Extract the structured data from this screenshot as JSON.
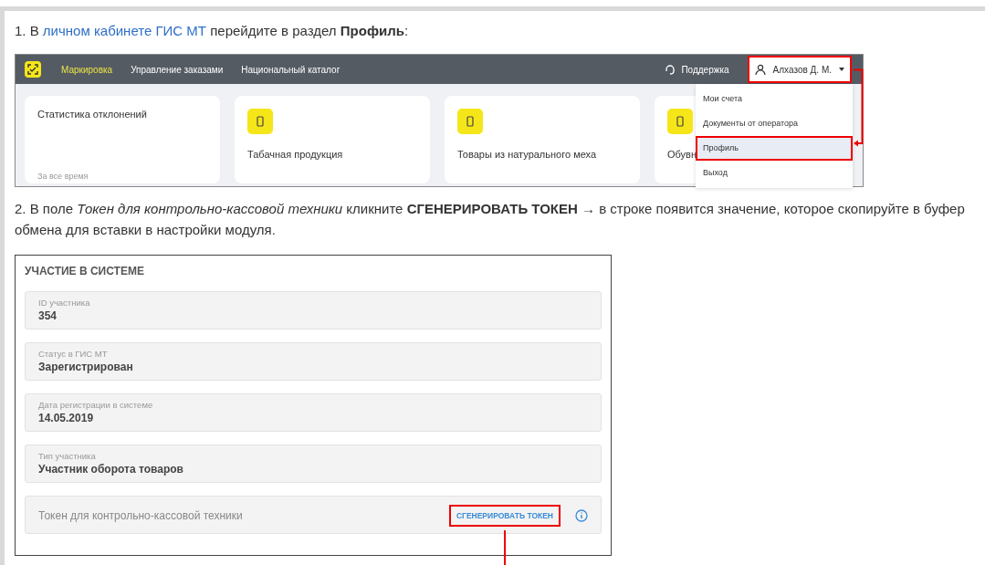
{
  "step1": {
    "prefix": "1. В ",
    "link": "личном кабинете ГИС МТ",
    "suffix": " перейдите в раздел **Профиль**:"
  },
  "screenshot1": {
    "nav": [
      {
        "label": "Маркировка",
        "selected": true
      },
      {
        "label": "Управление заказами",
        "selected": false
      },
      {
        "label": "Национальный каталог",
        "selected": false
      }
    ],
    "support": "Поддержка",
    "user": {
      "name": "Алхазов Д. М.",
      "highlighted": true
    },
    "cards": [
      {
        "kind": "stats",
        "title": "Статистика отклонений",
        "footer": "За все время"
      },
      {
        "kind": "category",
        "title": "Табачная продукция"
      },
      {
        "kind": "category",
        "title": "Товары из натурального меха"
      },
      {
        "kind": "category",
        "title": "Обувн"
      }
    ],
    "menu": [
      {
        "label": "Мои счета",
        "selected": false,
        "highlighted": false
      },
      {
        "label": "Документы от оператора",
        "selected": false,
        "highlighted": false
      },
      {
        "label": "Профиль",
        "selected": true,
        "highlighted": true
      },
      {
        "label": "Выход",
        "selected": false,
        "highlighted": false
      }
    ]
  },
  "step2": "2. В поле *Токен для контрольно-кассовой техники* кликните **СГЕНЕРИРОВАТЬ ТОКЕН** → в строке появится значение, которое скопируйте в буфер обмена для вставки в настройки модуля.",
  "screenshot2": {
    "title": "УЧАСТИЕ В СИСТЕМЕ",
    "fields": [
      {
        "kind": "value",
        "label": "ID участника",
        "value": "354"
      },
      {
        "kind": "value",
        "label": "Статус в ГИС МТ",
        "value": "Зарегистрирован"
      },
      {
        "kind": "value",
        "label": "Дата регистрации в системе",
        "value": "14.05.2019"
      },
      {
        "kind": "value",
        "label": "Тип участника",
        "value": "Участник оборота товаров"
      },
      {
        "kind": "token",
        "label": "Токен для контрольно-кассовой техники",
        "button": "СГЕНЕРИРОВАТЬ ТОКЕН",
        "highlighted": true
      }
    ]
  }
}
